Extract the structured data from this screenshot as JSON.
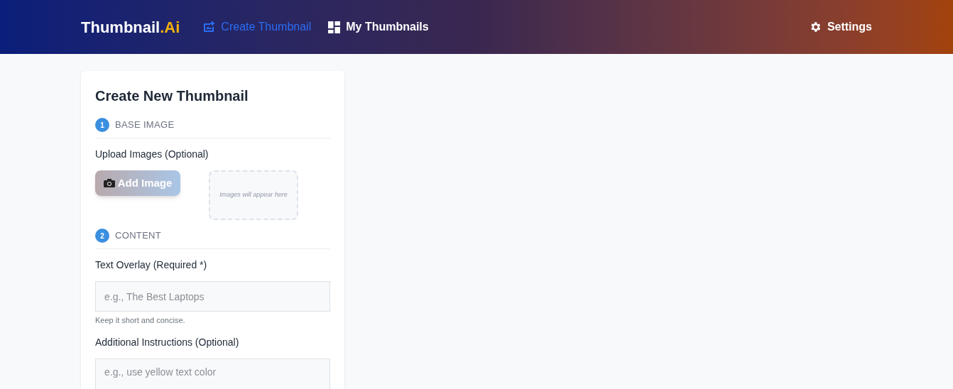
{
  "brand": {
    "name": "Thumbnail",
    "suffix": ".Ai"
  },
  "nav": [
    {
      "label": "Create Thumbnail",
      "kind": "create",
      "selected": true
    },
    {
      "label": "My Thumbnails",
      "kind": "gallery",
      "selected": false
    }
  ],
  "settings": {
    "label": "Settings"
  },
  "form": {
    "title": "Create New Thumbnail",
    "sections": [
      {
        "number": "1",
        "title": "BASE IMAGE",
        "fields": [
          {
            "kind": "upload",
            "label": "Upload Images (Optional)",
            "button": "Add Image",
            "preview_text": "Images will appear here"
          }
        ]
      },
      {
        "number": "2",
        "title": "CONTENT",
        "fields": [
          {
            "kind": "input",
            "label": "Text Overlay (Required *)",
            "placeholder": "e.g., The Best Laptops",
            "hint": "Keep it short and concise."
          },
          {
            "kind": "textarea",
            "label": "Additional Instructions (Optional)",
            "placeholder": "e.g., use yellow text color"
          }
        ]
      }
    ]
  }
}
